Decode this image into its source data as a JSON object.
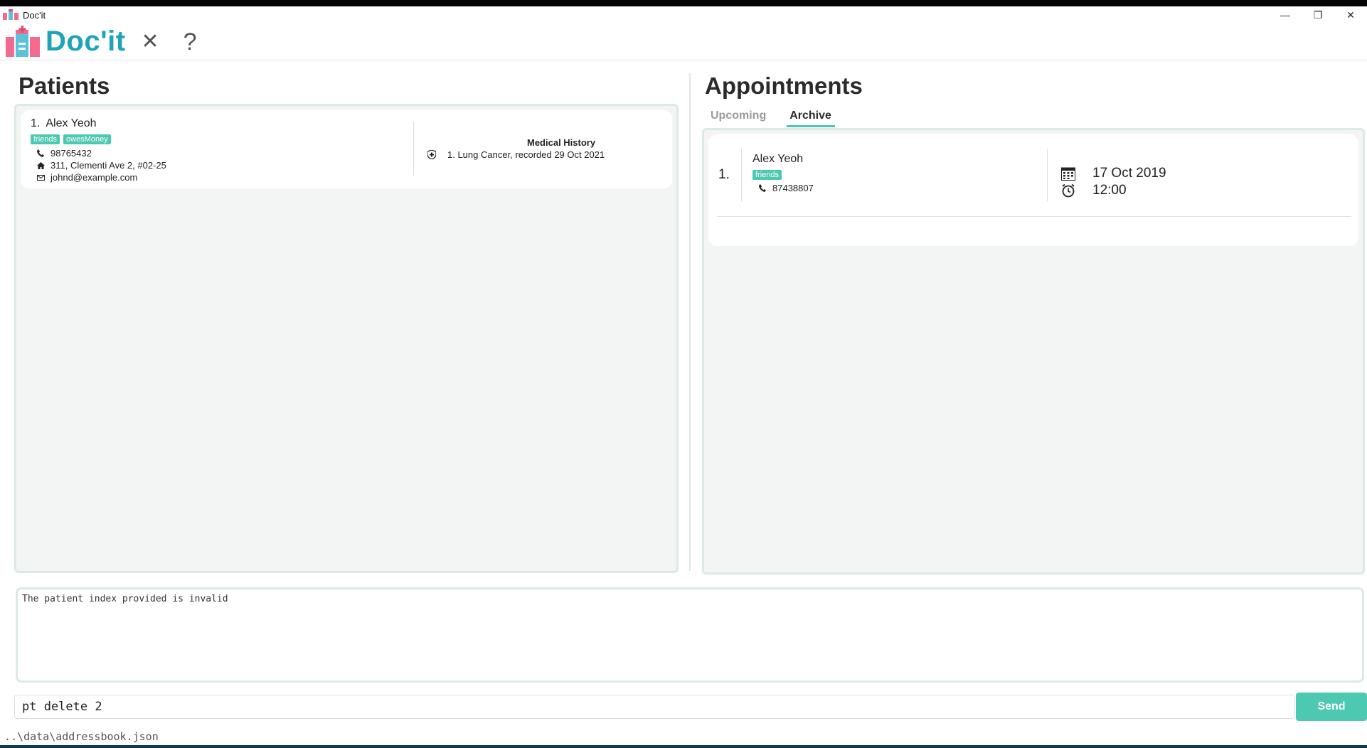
{
  "window": {
    "title": "Doc'it",
    "minimize": "—",
    "restore": "❐",
    "close": "✕"
  },
  "header": {
    "logo_text": "Doc'it",
    "exit_label": "✕",
    "help_label": "?"
  },
  "patients": {
    "title": "Patients",
    "items": [
      {
        "index": "1.",
        "name": "Alex Yeoh",
        "tags": [
          "friends",
          "owesMoney"
        ],
        "phone": "98765432",
        "address": "311, Clementi Ave 2, #02-25",
        "email": "johnd@example.com",
        "medical_history_title": "Medical History",
        "medical_history": [
          "1. Lung Cancer, recorded 29 Oct 2021"
        ]
      }
    ]
  },
  "appointments": {
    "title": "Appointments",
    "tabs": [
      {
        "label": "Upcoming",
        "active": false
      },
      {
        "label": "Archive",
        "active": true
      }
    ],
    "items": [
      {
        "index": "1.",
        "name": "Alex Yeoh",
        "tags": [
          "friends"
        ],
        "phone": "87438807",
        "date": "17 Oct 2019",
        "time": "12:00"
      }
    ]
  },
  "result_display": {
    "text": "The patient index provided is invalid"
  },
  "command_box": {
    "value": "pt delete 2",
    "send_label": "Send"
  },
  "status_bar": {
    "path": "..\\data\\addressbook.json"
  },
  "colors": {
    "accent": "#4cc9b0",
    "logo": "#1fa3b8",
    "panel_bg": "#f3f5f5"
  }
}
